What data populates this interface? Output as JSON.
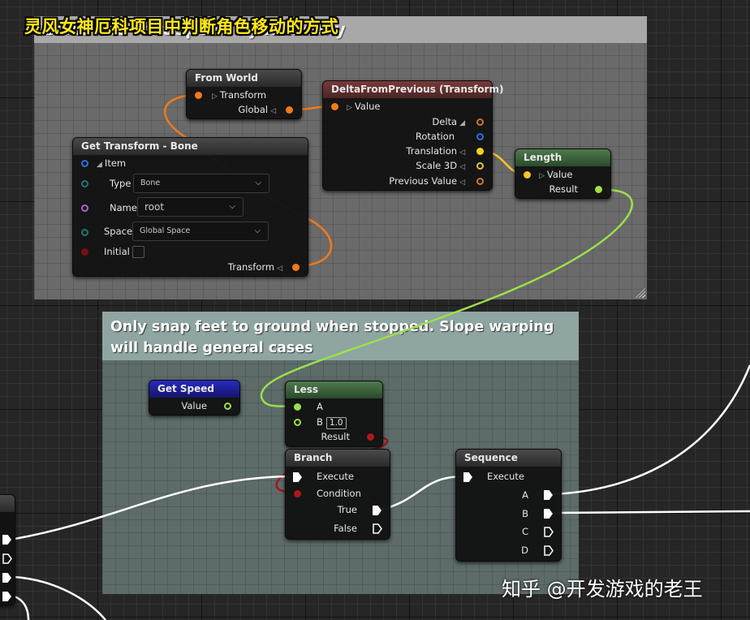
{
  "overlay": {
    "title": "灵风女神厄科项目中判断角色移动的方式",
    "watermark": "知乎 @开发游戏的老王"
  },
  "comments": {
    "top": {
      "title": "Calculate foot speed dynamically"
    },
    "bottom": {
      "title": "Only snap feet to ground when stopped. Slope warping will handle general cases"
    }
  },
  "nodes": {
    "from_world": {
      "title": "From World",
      "inputs": [
        {
          "label": "Transform",
          "color": "#f07b1a"
        }
      ],
      "outputs": [
        {
          "label": "Global",
          "color": "#f07b1a"
        }
      ]
    },
    "delta_from_previous": {
      "title": "DeltaFromPrevious (Transform)",
      "inputs": [
        {
          "label": "Value",
          "color": "#f07b1a"
        }
      ],
      "outputs": [
        {
          "label": "Delta",
          "color": "#d2752a"
        },
        {
          "label": "Rotation",
          "color": "#2f6fe0"
        },
        {
          "label": "Translation",
          "color": "#f5d31d"
        },
        {
          "label": "Scale 3D",
          "color": "#e0c43a"
        },
        {
          "label": "Previous Value",
          "color": "#d2752a"
        }
      ]
    },
    "get_transform_bone": {
      "title": "Get Transform - Bone",
      "item_label": "Item",
      "type_label": "Type",
      "type_value": "Bone",
      "name_label": "Name",
      "name_value": "root",
      "space_label": "Space",
      "space_value": "Global Space",
      "initial_label": "Initial",
      "initial_checked": false,
      "output_label": "Transform"
    },
    "length": {
      "title": "Length",
      "input_label": "Value",
      "output_label": "Result"
    },
    "get_speed": {
      "title": "Get Speed",
      "output_label": "Value"
    },
    "less": {
      "title": "Less",
      "a_label": "A",
      "b_label": "B",
      "b_value": "1.0",
      "output_label": "Result"
    },
    "branch": {
      "title": "Branch",
      "execute_label": "Execute",
      "condition_label": "Condition",
      "true_label": "True",
      "false_label": "False"
    },
    "sequence": {
      "title": "Sequence",
      "execute_label": "Execute",
      "outputs": [
        "A",
        "B",
        "C",
        "D"
      ]
    }
  },
  "colors": {
    "transform_pin": "#f07b1a",
    "vector_pin": "#f5d31d",
    "float_pin": "#9be04a",
    "bool_pin": "#b01818",
    "exec_wire": "#ffffff"
  }
}
